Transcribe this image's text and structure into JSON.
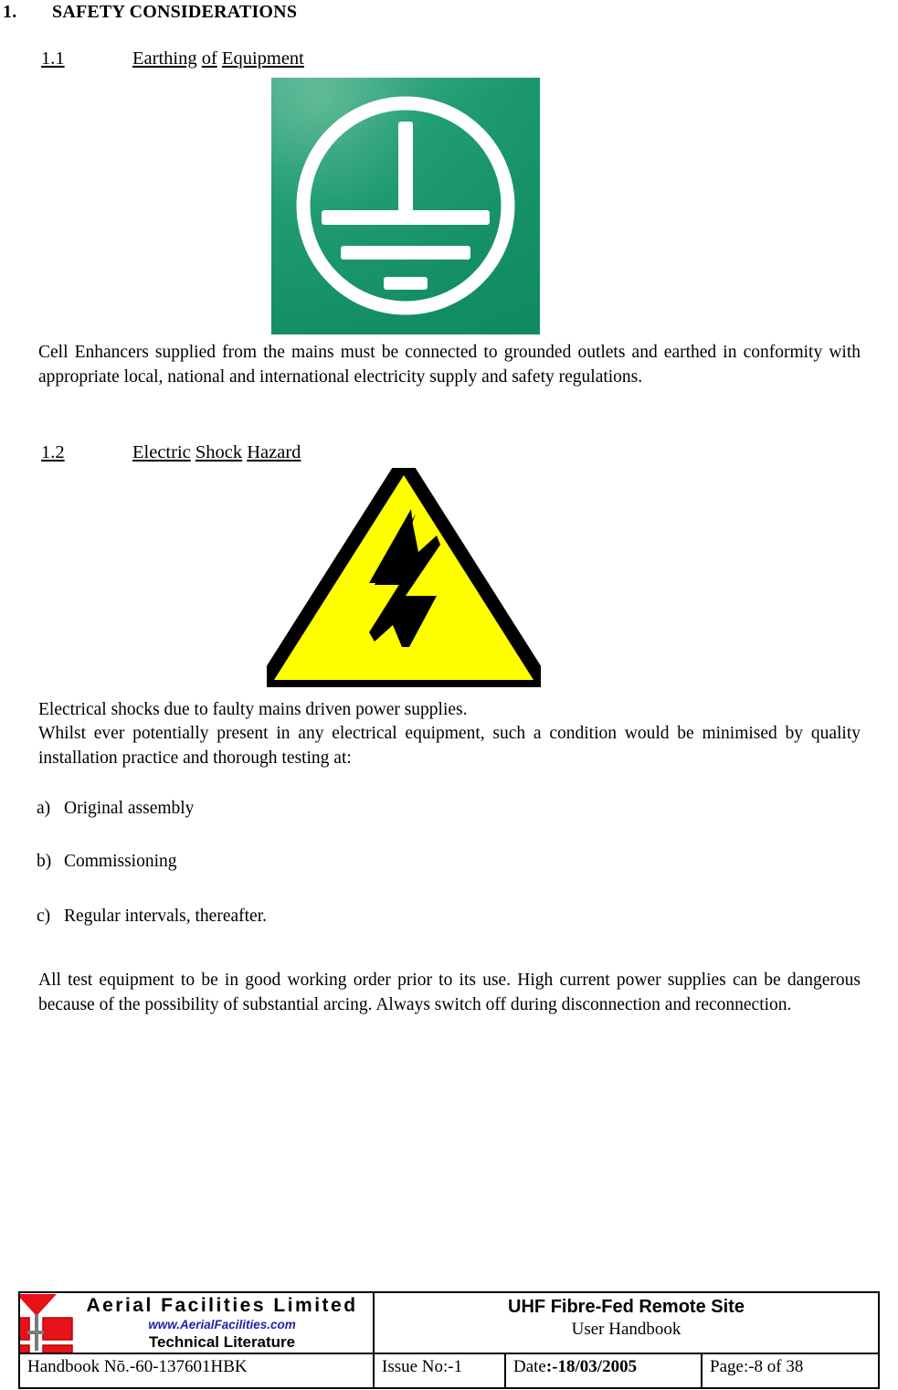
{
  "document": {
    "section": {
      "number": "1.",
      "title": "SAFETY CONSIDERATIONS"
    },
    "subsections": [
      {
        "number": "1.1",
        "title_words": [
          "Earthing",
          "of",
          "Equipment"
        ],
        "image": {
          "name": "earthing-symbol",
          "alt": "Protective earth / ground symbol, white on green",
          "background_color": "#12946a",
          "symbol_color": "#ffffff"
        },
        "body": "Cell Enhancers supplied from the mains must be connected to grounded outlets and earthed in conformity with appropriate local, national and international electricity supply and safety regulations."
      },
      {
        "number": "1.2",
        "title_words": [
          "Electric",
          "Shock",
          "Hazard"
        ],
        "image": {
          "name": "electric-shock-hazard-symbol",
          "alt": "Yellow warning triangle with black lightning bolt",
          "background_color": "#ffff00",
          "border_color": "#000000",
          "symbol_color": "#000000"
        },
        "body_line_1": "Electrical shocks due to faulty mains driven power supplies.",
        "body_line_2": "Whilst ever potentially present in any electrical equipment, such a condition would be minimised by quality installation practice and thorough testing at:",
        "list": [
          {
            "marker": "a)",
            "text": "Original assembly"
          },
          {
            "marker": "b)",
            "text": "Commissioning"
          },
          {
            "marker": "c)",
            "text": "Regular intervals, thereafter."
          }
        ],
        "closing": "All test equipment to be in good working order prior to its use. High current power supplies can be dangerous because of the possibility of substantial arcing. Always switch off during disconnection and reconnection."
      }
    ]
  },
  "footer": {
    "company": {
      "name": "Aerial  Facilities  Limited",
      "url": "www.AerialFacilities.com",
      "tagline": "Technical Literature",
      "url_color": "#2222aa",
      "logo_color": "#e8111a"
    },
    "title_main": "UHF Fibre-Fed Remote Site",
    "title_sub": "User Handbook",
    "handbook_label": "Handbook N",
    "handbook_number": "ō.-60-137601HBK",
    "handbook_full": "Handbook Nō.-60-137601HBK",
    "issue_label": "Issue No:-",
    "issue_value": "1",
    "date_label": "Date",
    "date_value": ":-18/03/2005",
    "page_label": "Page",
    "page_value": ":-8 of 38"
  }
}
